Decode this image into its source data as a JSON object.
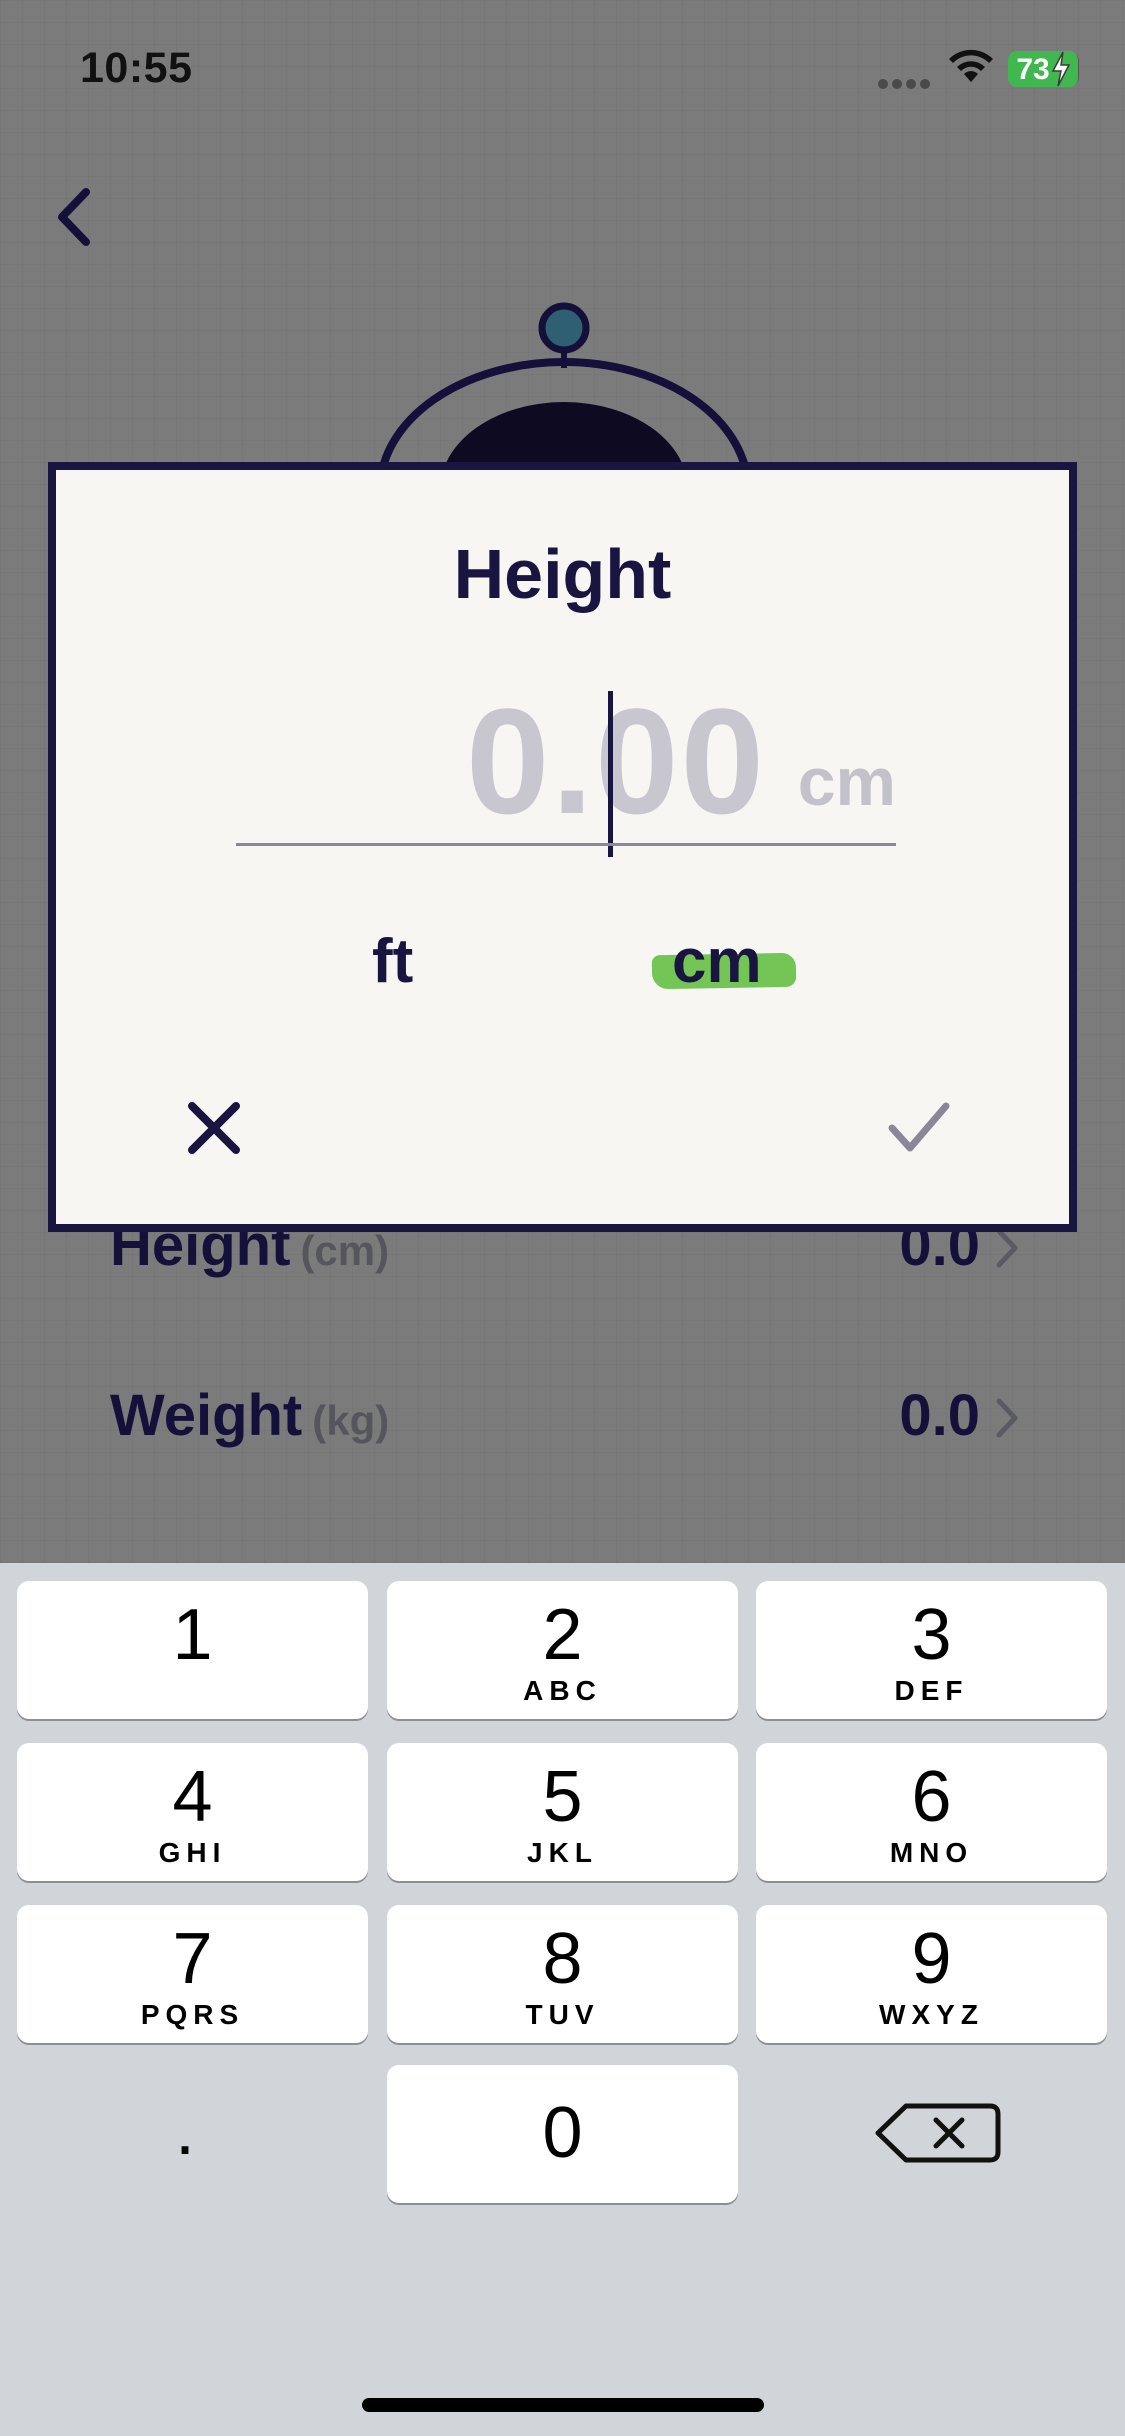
{
  "status_bar": {
    "time": "10:55",
    "battery_level": "73"
  },
  "background": {
    "rows": [
      {
        "label": "Height",
        "unit": "(cm)",
        "value": "0.0"
      },
      {
        "label": "Weight",
        "unit": "(kg)",
        "value": "0.0"
      }
    ]
  },
  "dialog": {
    "title": "Height",
    "input": {
      "value": "0.00",
      "unit": "cm"
    },
    "unit_options": [
      {
        "label": "ft",
        "selected": false
      },
      {
        "label": "cm",
        "selected": true
      }
    ],
    "highlight_color": "#73c656"
  },
  "keyboard": {
    "keys": [
      {
        "digit": "1",
        "letters": ""
      },
      {
        "digit": "2",
        "letters": "ABC"
      },
      {
        "digit": "3",
        "letters": "DEF"
      },
      {
        "digit": "4",
        "letters": "GHI"
      },
      {
        "digit": "5",
        "letters": "JKL"
      },
      {
        "digit": "6",
        "letters": "MNO"
      },
      {
        "digit": "7",
        "letters": "PQRS"
      },
      {
        "digit": "8",
        "letters": "TUV"
      },
      {
        "digit": "9",
        "letters": "WXYZ"
      },
      {
        "digit": "0",
        "letters": ""
      }
    ],
    "decimal_key": "."
  }
}
